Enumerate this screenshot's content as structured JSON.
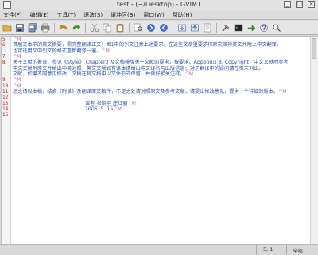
{
  "window": {
    "title": "test - (~/Desktop) - GVIM1"
  },
  "menubar": {
    "items": [
      {
        "label": "文件(F)"
      },
      {
        "label": "编辑(E)"
      },
      {
        "label": "工具(T)"
      },
      {
        "label": "语法(S)"
      },
      {
        "label": "缓冲区(B)"
      },
      {
        "label": "窗口(W)"
      },
      {
        "label": "帮助(H)"
      }
    ]
  },
  "editor": {
    "lines": [
      {
        "num": "5",
        "text": ""
      },
      {
        "num": "6",
        "text": "首届文本中的英文摘要，需完整翻译正文；图1中的引文注意上述要求，在这些文章里要求将原文保持英文并附上中文翻译。"
      },
      {
        "num": "",
        "text": "也可选用文中引文的格式重新翻译一遍。"
      },
      {
        "num": "7",
        "text": ""
      },
      {
        "num": "8",
        "text": "关于文献的著录，参见《Style》 Chapter3 及文档模版关于文献的要求，按要求，Appendix B. Copyright，中文文献附参考"
      },
      {
        "num": "",
        "text": "中文文献附原文并给出中英对照；英文文献如有译本请给出中文译名与出版信息；对于翻译中的疑问请在页末列出。"
      },
      {
        "num": "",
        "text": "文献，如果不同意见修改，文稿在其文档中以文件形式保留，并做好相关注释。"
      },
      {
        "num": "9",
        "text": ""
      },
      {
        "num": "10",
        "text": ""
      },
      {
        "num": "11",
        "text": "总之请以本稿、结合《附录》及翻译原文稿件，不足之处请对照原文及参考文献，请提出修改意见，提供一个详细的版本。"
      },
      {
        "num": "12",
        "text": ""
      },
      {
        "num": "13",
        "text": "",
        "sig": "译者  张晓明  庄红丽"
      },
      {
        "num": "14",
        "text": "",
        "sig": "2006. 5. 15"
      },
      {
        "num": "15",
        "text": ""
      }
    ],
    "eol": "^M"
  },
  "status": {
    "position": "5, 1",
    "mode": "全部"
  }
}
